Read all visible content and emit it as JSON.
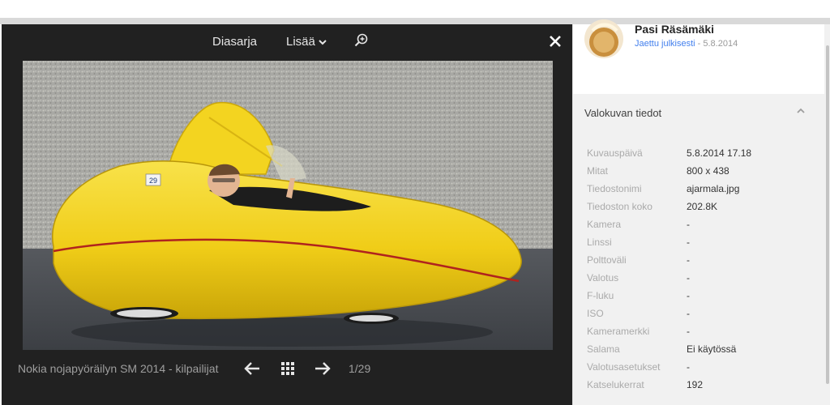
{
  "toolbar": {
    "slideshow_label": "Diasarja",
    "more_label": "Lisää",
    "zoom_icon": "zoom-in-icon",
    "close_icon": "close-icon"
  },
  "photo": {
    "race_number": "29",
    "subject": "yellow velomobile with driver"
  },
  "bottom": {
    "album_title": "Nokia nojapyöräilyn SM 2014 - kilpailijat",
    "counter": "1/29"
  },
  "owner": {
    "name": "Pasi Räsämäki",
    "shared_label": "Jaettu julkisesti",
    "date": " - 5.8.2014"
  },
  "details": {
    "title": "Valokuvan tiedot",
    "rows": [
      {
        "key": "Kuvauspäivä",
        "value": "5.8.2014 17.18"
      },
      {
        "key": "Mitat",
        "value": "800 x 438"
      },
      {
        "key": "Tiedostonimi",
        "value": "ajarmala.jpg"
      },
      {
        "key": "Tiedoston koko",
        "value": "202.8K"
      },
      {
        "key": "Kamera",
        "value": "-"
      },
      {
        "key": "Linssi",
        "value": "-"
      },
      {
        "key": "Polttoväli",
        "value": "-"
      },
      {
        "key": "Valotus",
        "value": "-"
      },
      {
        "key": "F-luku",
        "value": "-"
      },
      {
        "key": "ISO",
        "value": "-"
      },
      {
        "key": "Kameramerkki",
        "value": "-"
      },
      {
        "key": "Salama",
        "value": "Ei käytössä"
      },
      {
        "key": "Valotusasetukset",
        "value": "-"
      },
      {
        "key": "Katselukerrat",
        "value": "192"
      }
    ]
  },
  "colors": {
    "viewer_bg": "#212121",
    "sidebar_bg": "#f1f1f1",
    "link": "#427fed",
    "car_yellow": "#f4d21c"
  }
}
